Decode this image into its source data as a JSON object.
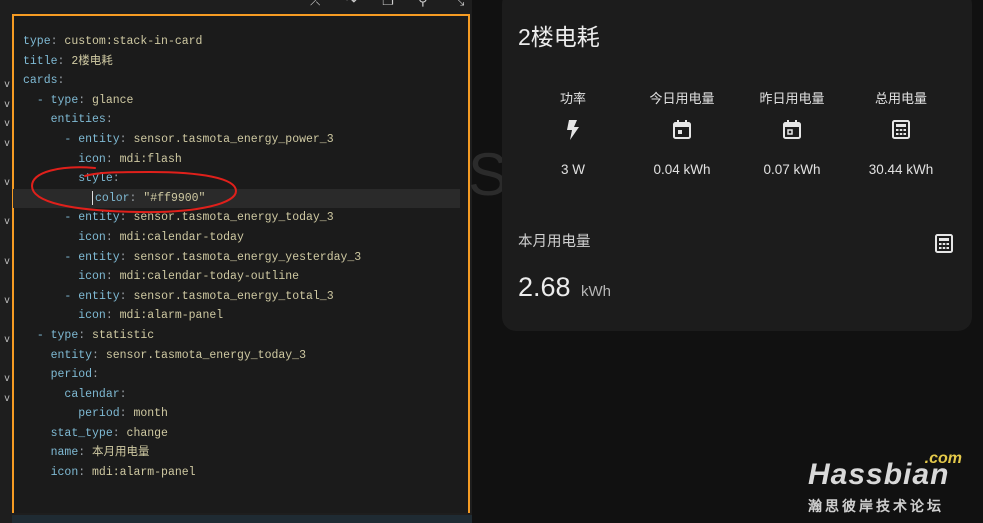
{
  "editor": {
    "lines": [
      {
        "indent": "",
        "dash": false,
        "key": "type",
        "val": "custom:stack-in-card",
        "fold": false
      },
      {
        "indent": "",
        "dash": false,
        "key": "title",
        "val": "2楼电耗",
        "fold": false
      },
      {
        "indent": "",
        "dash": false,
        "key": "cards",
        "val": "",
        "fold": true
      },
      {
        "indent": "  ",
        "dash": true,
        "key": "type",
        "val": "glance",
        "fold": true
      },
      {
        "indent": "    ",
        "dash": false,
        "key": "entities",
        "val": "",
        "fold": true
      },
      {
        "indent": "      ",
        "dash": true,
        "key": "entity",
        "val": "sensor.tasmota_energy_power_3",
        "fold": true
      },
      {
        "indent": "        ",
        "dash": false,
        "key": "icon",
        "val": "mdi:flash",
        "fold": false
      },
      {
        "indent": "        ",
        "dash": false,
        "key": "style",
        "val": "",
        "fold": true
      },
      {
        "indent": "          ",
        "dash": false,
        "key": "color",
        "val": "\"#ff9900\"",
        "fold": false,
        "active": true
      },
      {
        "indent": "      ",
        "dash": true,
        "key": "entity",
        "val": "sensor.tasmota_energy_today_3",
        "fold": true
      },
      {
        "indent": "        ",
        "dash": false,
        "key": "icon",
        "val": "mdi:calendar-today",
        "fold": false
      },
      {
        "indent": "      ",
        "dash": true,
        "key": "entity",
        "val": "sensor.tasmota_energy_yesterday_3",
        "fold": true
      },
      {
        "indent": "        ",
        "dash": false,
        "key": "icon",
        "val": "mdi:calendar-today-outline",
        "fold": false
      },
      {
        "indent": "      ",
        "dash": true,
        "key": "entity",
        "val": "sensor.tasmota_energy_total_3",
        "fold": true
      },
      {
        "indent": "        ",
        "dash": false,
        "key": "icon",
        "val": "mdi:alarm-panel",
        "fold": false
      },
      {
        "indent": "  ",
        "dash": true,
        "key": "type",
        "val": "statistic",
        "fold": true
      },
      {
        "indent": "    ",
        "dash": false,
        "key": "entity",
        "val": "sensor.tasmota_energy_today_3",
        "fold": false
      },
      {
        "indent": "    ",
        "dash": false,
        "key": "period",
        "val": "",
        "fold": true
      },
      {
        "indent": "      ",
        "dash": false,
        "key": "calendar",
        "val": "",
        "fold": true
      },
      {
        "indent": "        ",
        "dash": false,
        "key": "period",
        "val": "month",
        "fold": false
      },
      {
        "indent": "    ",
        "dash": false,
        "key": "stat_type",
        "val": "change",
        "fold": false
      },
      {
        "indent": "    ",
        "dash": false,
        "key": "name",
        "val": "本月用电量",
        "fold": false
      },
      {
        "indent": "    ",
        "dash": false,
        "key": "icon",
        "val": "mdi:alarm-panel",
        "fold": false
      }
    ],
    "fold_glyph": "v",
    "toolbar_icons": [
      "format-icon",
      "redo-icon",
      "copy-icon",
      "search-icon",
      "collapse-icon"
    ],
    "accent_color": "#f59b23",
    "annotation_color": "#e0201b"
  },
  "card": {
    "title": "2楼电耗",
    "glance": [
      {
        "label": "功率",
        "icon": "flash-icon",
        "value": "3 W"
      },
      {
        "label": "今日用电量",
        "icon": "calendar-today-icon",
        "value": "0.04 kWh"
      },
      {
        "label": "昨日用电量",
        "icon": "calendar-today-outline-icon",
        "value": "0.07 kWh"
      },
      {
        "label": "总用电量",
        "icon": "alarm-panel-icon",
        "value": "30.44 kWh"
      }
    ],
    "statistic": {
      "name": "本月用电量",
      "icon": "alarm-panel-icon",
      "value": "2.68",
      "unit": "kWh"
    }
  },
  "watermark": {
    "com": ".com",
    "brand": "Hassbian",
    "subtitle": "瀚思彼岸技术论坛"
  }
}
